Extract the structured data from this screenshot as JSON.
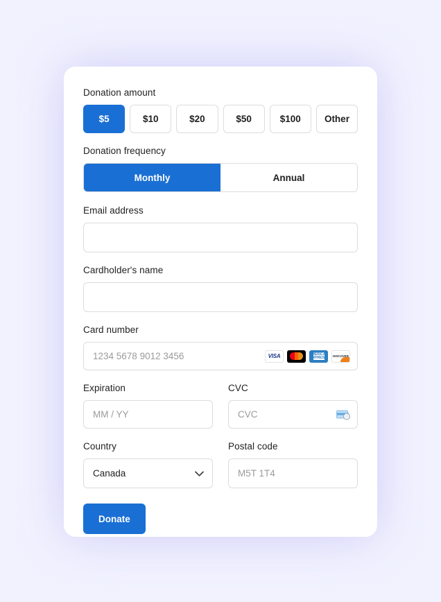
{
  "theme": {
    "page_background": "#f1f2fe",
    "card_background": "#ffffff",
    "accent_blue": "#1a6fd4",
    "border_grey": "#dcdcdc",
    "placeholder_grey": "#9b9b9b",
    "glow": "#c9c6f7"
  },
  "donation_amount": {
    "label": "Donation amount",
    "options": [
      {
        "label": "$5",
        "selected": true
      },
      {
        "label": "$10",
        "selected": false
      },
      {
        "label": "$20",
        "selected": false
      },
      {
        "label": "$50",
        "selected": false
      },
      {
        "label": "$100",
        "selected": false
      },
      {
        "label": "Other",
        "selected": false
      }
    ]
  },
  "donation_frequency": {
    "label": "Donation frequency",
    "options": [
      {
        "label": "Monthly",
        "selected": true
      },
      {
        "label": "Annual",
        "selected": false
      }
    ]
  },
  "email": {
    "label": "Email address",
    "value": "",
    "placeholder": ""
  },
  "cardholder": {
    "label": "Cardholder's name",
    "value": "",
    "placeholder": ""
  },
  "card_number": {
    "label": "Card number",
    "value": "",
    "placeholder": "1234 5678 9012 3456",
    "brands": [
      {
        "name": "visa-icon",
        "text": "VISA"
      },
      {
        "name": "mastercard-icon",
        "text": ""
      },
      {
        "name": "amex-icon",
        "text": "AMERICAN EXPRESS"
      },
      {
        "name": "discover-icon",
        "text": "DISCOVER"
      }
    ]
  },
  "expiration": {
    "label": "Expiration",
    "value": "",
    "placeholder": "MM / YY"
  },
  "cvc": {
    "label": "CVC",
    "value": "",
    "placeholder": "CVC"
  },
  "country": {
    "label": "Country",
    "value": "Canada",
    "options": [
      "Canada"
    ]
  },
  "postal_code": {
    "label": "Postal code",
    "value": "",
    "placeholder": "M5T 1T4"
  },
  "submit": {
    "label": "Donate"
  }
}
